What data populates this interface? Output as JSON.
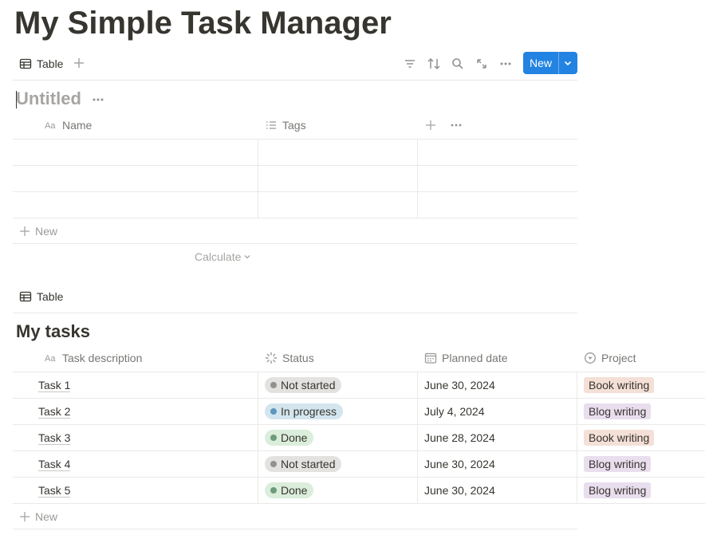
{
  "page": {
    "title": "My Simple Task Manager"
  },
  "view1": {
    "tab_label": "Table",
    "new_button_label": "New",
    "database_title": "Untitled",
    "columns": [
      "Name",
      "Tags"
    ],
    "new_row_label": "New",
    "calculate_label": "Calculate"
  },
  "view2": {
    "tab_label": "Table",
    "database_title": "My tasks",
    "columns": {
      "task": "Task description",
      "status": "Status",
      "date": "Planned date",
      "project": "Project"
    },
    "rows": [
      {
        "task": "Task 1",
        "status": "Not started",
        "status_color": "#91918e",
        "status_bg": "#e3e2e0",
        "date": "June 30, 2024",
        "project": "Book writing",
        "project_bg": "#f4e0d7"
      },
      {
        "task": "Task 2",
        "status": "In progress",
        "status_color": "#5b97bd",
        "status_bg": "#d3e5ef",
        "date": "July 4, 2024",
        "project": "Blog writing",
        "project_bg": "#e8deee"
      },
      {
        "task": "Task 3",
        "status": "Done",
        "status_color": "#6c9b7d",
        "status_bg": "#dbeddb",
        "date": "June 28, 2024",
        "project": "Book writing",
        "project_bg": "#f4e0d7"
      },
      {
        "task": "Task 4",
        "status": "Not started",
        "status_color": "#91918e",
        "status_bg": "#e3e2e0",
        "date": "June 30, 2024",
        "project": "Blog writing",
        "project_bg": "#e8deee"
      },
      {
        "task": "Task 5",
        "status": "Done",
        "status_color": "#6c9b7d",
        "status_bg": "#dbeddb",
        "date": "June 30, 2024",
        "project": "Blog writing",
        "project_bg": "#e8deee"
      }
    ],
    "new_row_label": "New"
  },
  "colors": {
    "accent": "#2383e2",
    "border": "#e9e9e7",
    "muted_text": "#787774"
  }
}
